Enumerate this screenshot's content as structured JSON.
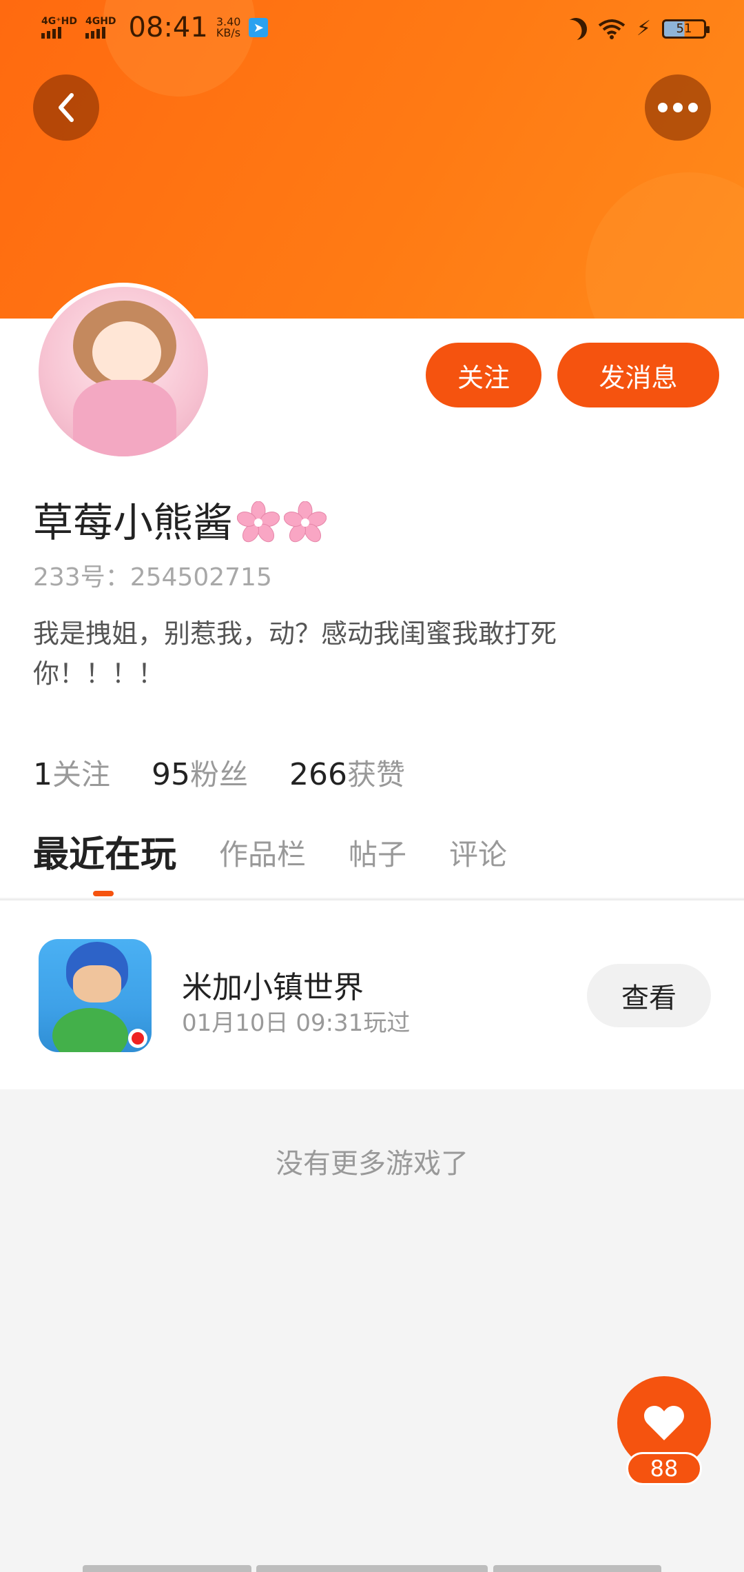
{
  "status_bar": {
    "signal1": "4G⁺HD",
    "signal2": "4GHD",
    "time": "08:41",
    "rate_value": "3.40",
    "rate_unit": "KB/s",
    "battery": "51"
  },
  "header": {
    "back_icon": "chevron-left-icon",
    "more_icon": "more-dots-icon"
  },
  "profile": {
    "follow_label": "关注",
    "message_label": "发消息",
    "nickname": "草莓小熊酱",
    "uid": "233号：254502715",
    "bio": "我是拽姐，别惹我，动？感动我闺蜜我敢打死你！！！！",
    "stats": [
      {
        "num": "1",
        "label": "关注"
      },
      {
        "num": "95",
        "label": "粉丝"
      },
      {
        "num": "266",
        "label": "获赞"
      }
    ]
  },
  "tabs": [
    "最近在玩",
    "作品栏",
    "帖子",
    "评论"
  ],
  "game": {
    "title": "米加小镇世界",
    "time": "01月10日 09:31玩过",
    "view_label": "查看"
  },
  "empty_text": "没有更多游戏了",
  "like": {
    "icon": "heart-icon",
    "count": "88"
  },
  "colors": {
    "accent": "#f5530f",
    "banner": "#ff7614"
  }
}
